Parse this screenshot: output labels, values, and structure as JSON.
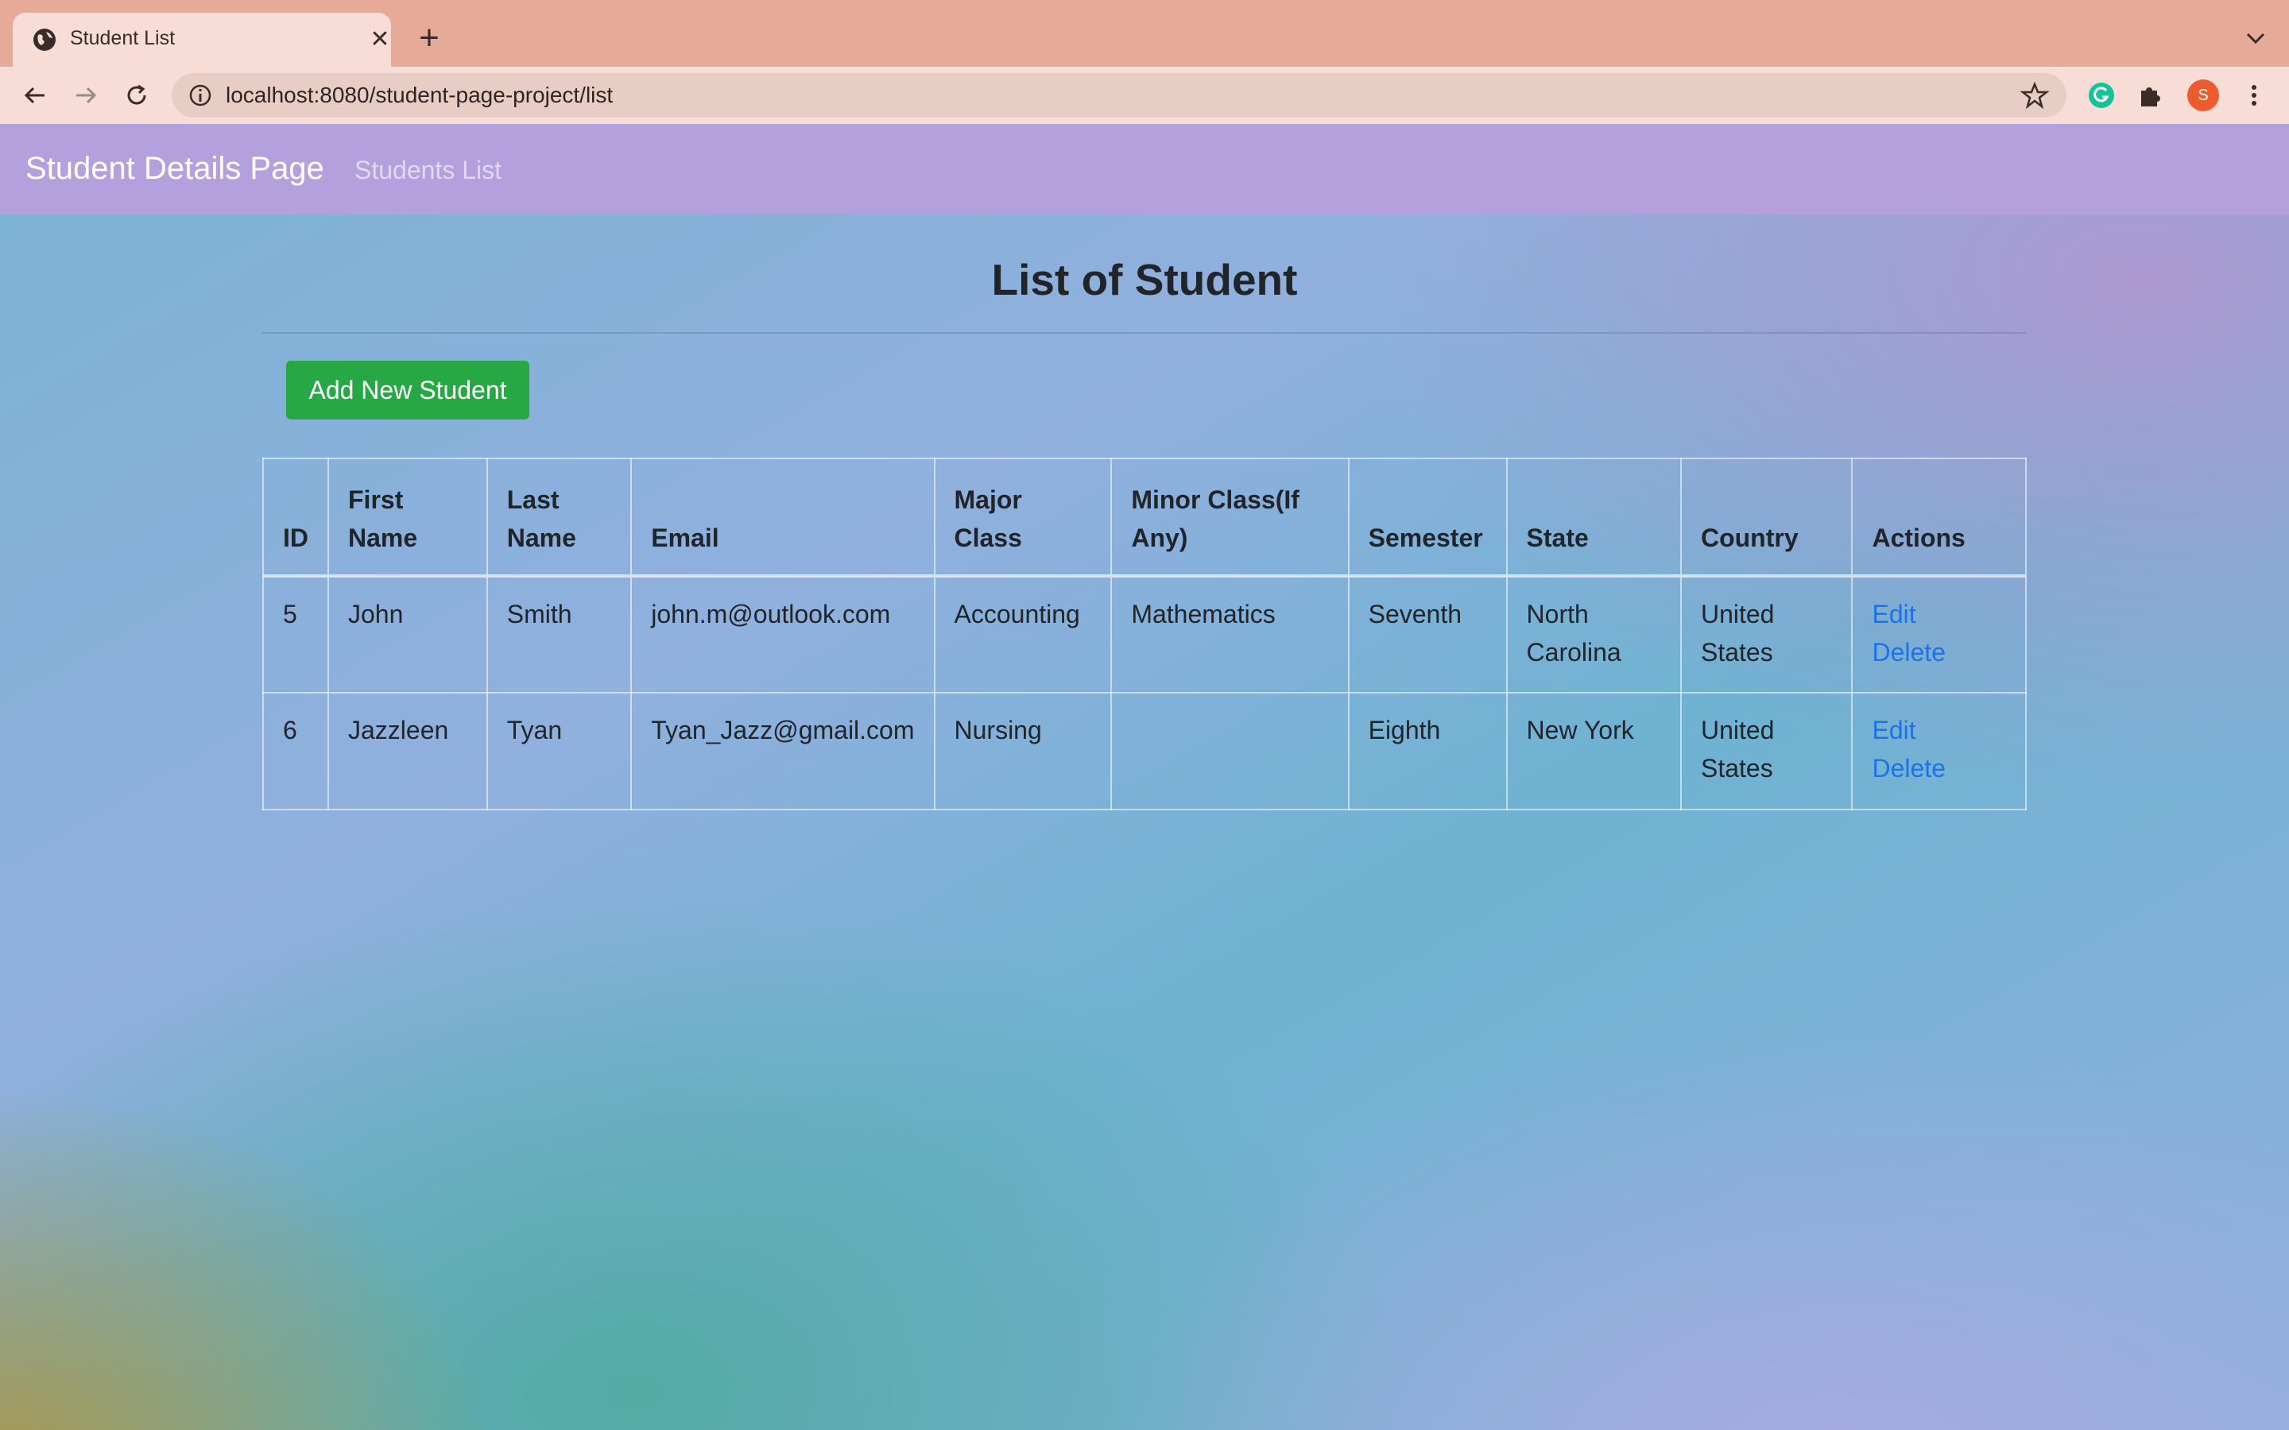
{
  "browser": {
    "tab_title": "Student List",
    "tab_close": "✕",
    "new_tab": "+",
    "url": "localhost:8080/student-page-project/list",
    "profile_initial": "S"
  },
  "navbar": {
    "brand": "Student Details Page",
    "link": "Students List"
  },
  "page": {
    "title": "List of Student",
    "add_button": "Add New Student"
  },
  "table": {
    "headers": [
      "ID",
      "First Name",
      "Last Name",
      "Email",
      "Major Class",
      "Minor Class(If Any)",
      "Semester",
      "State",
      "Country",
      "Actions"
    ],
    "rows": [
      {
        "id": "5",
        "first_name": "John",
        "last_name": "Smith",
        "email": "john.m@outlook.com",
        "major": "Accounting",
        "minor": "Mathematics",
        "semester": "Seventh",
        "state": "North Carolina",
        "country": "United States",
        "edit": "Edit",
        "delete": "Delete"
      },
      {
        "id": "6",
        "first_name": "Jazzleen",
        "last_name": "Tyan",
        "email": "Tyan_Jazz@gmail.com",
        "major": "Nursing",
        "minor": "",
        "semester": "Eighth",
        "state": "New York",
        "country": "United States",
        "edit": "Edit",
        "delete": "Delete"
      }
    ]
  },
  "colors": {
    "navbar": "#b3a0dc",
    "button": "#28a745",
    "link": "#1a73e8"
  }
}
